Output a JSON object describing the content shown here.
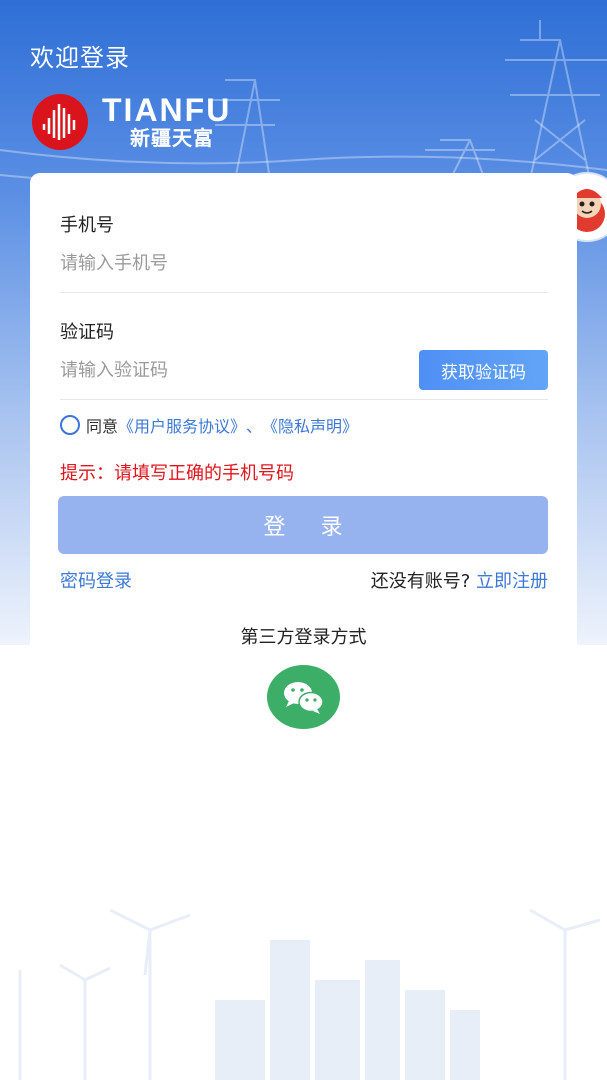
{
  "header": {
    "welcome_title": "欢迎登录",
    "brand_en": "TIANFU",
    "brand_cn": "新疆天富"
  },
  "form": {
    "phone_label": "手机号",
    "phone_placeholder": "请输入手机号",
    "code_label": "验证码",
    "code_placeholder": "请输入验证码",
    "get_code_button": "获取验证码",
    "agree_prefix": "同意",
    "agreement_link": "《用户服务协议》",
    "separator": "、",
    "privacy_link": "《隐私声明》",
    "hint": "提示：请填写正确的手机号码",
    "login_button": "登 录"
  },
  "links": {
    "password_login": "密码登录",
    "no_account": "还没有账号?",
    "register": "立即注册"
  },
  "third_party": {
    "title": "第三方登录方式",
    "icon": "wechat-icon"
  },
  "colors": {
    "primary": "#3e78d6",
    "login_button": "#97b3ef",
    "hint": "#e0161e",
    "wechat": "#3dae68",
    "logo": "#d9141c"
  }
}
